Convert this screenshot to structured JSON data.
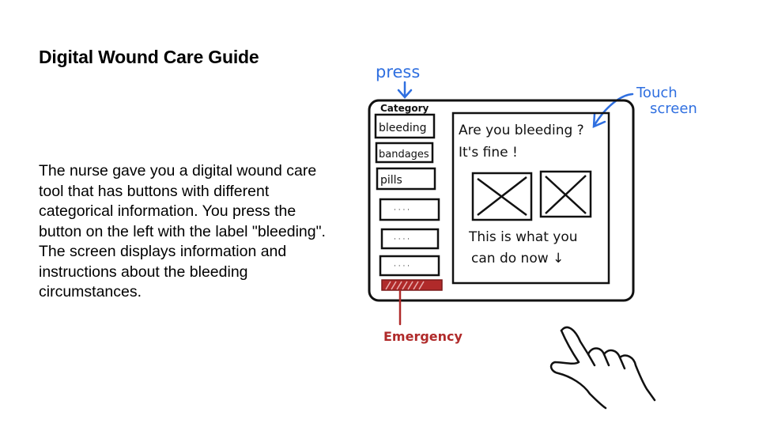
{
  "slide": {
    "title": "Digital Wound Care Guide",
    "body": "The nurse gave you a digital wound care tool that has buttons with different categorical information. You press the button on the left with the label \"bleeding\". The screen displays information and instructions about the bleeding circumstances."
  },
  "sketch": {
    "annotation_press": "press",
    "annotation_touch": "Touch",
    "annotation_screen": "screen",
    "annotation_emergency": "Emergency",
    "sidebar_header": "Category",
    "categories": [
      "bleeding",
      "bandages",
      "pills"
    ],
    "placeholder_label": "· · · ·",
    "screen_line1": "Are you bleeding ?",
    "screen_line2": "It's fine !",
    "screen_line3": "This is what you",
    "screen_line4": "can do now ↓",
    "colors": {
      "annotation_blue": "#2f6fe0",
      "emergency_red": "#b02a2a",
      "ink": "#111111"
    }
  }
}
